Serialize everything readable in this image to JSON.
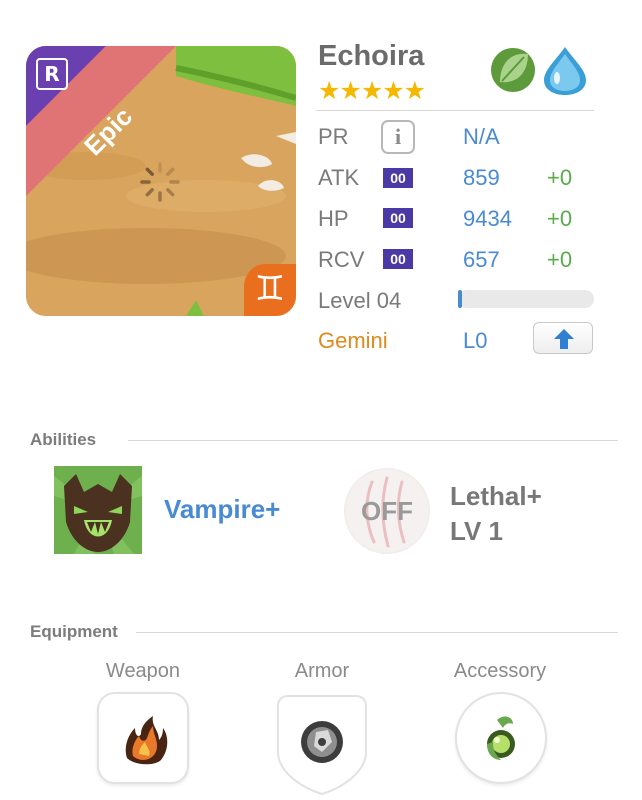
{
  "monster": {
    "name": "Echoira",
    "rarity": "Epic",
    "rank_icon": "R",
    "stars": "★★★★★",
    "star_count": 5,
    "elements": [
      "leaf-element-icon",
      "water-element-icon"
    ],
    "zodiac_symbol": "♊"
  },
  "stats": {
    "pr": {
      "label": "PR",
      "value": "N/A"
    },
    "atk": {
      "label": "ATK",
      "badge": "00",
      "value": "859",
      "bonus": "+0"
    },
    "hp": {
      "label": "HP",
      "badge": "00",
      "value": "9434",
      "bonus": "+0"
    },
    "rcv": {
      "label": "RCV",
      "badge": "00",
      "value": "657",
      "bonus": "+0"
    },
    "level": {
      "label": "Level 04",
      "progress": 0.03
    },
    "zodiac": {
      "label": "Gemini",
      "level": "L0"
    }
  },
  "abilities": {
    "title": "Abilities",
    "active": {
      "name": "Vampire+"
    },
    "leader": {
      "state": "OFF",
      "name": "Lethal+",
      "level": "LV 1"
    }
  },
  "equipment": {
    "title": "Equipment",
    "slots": [
      {
        "label": "Weapon"
      },
      {
        "label": "Armor"
      },
      {
        "label": "Accessory"
      }
    ]
  },
  "colors": {
    "accent_blue": "#4a8ad2",
    "bonus_green": "#5aab4b",
    "zodiac_orange": "#e08a1e",
    "epic_ribbon": "#e07474",
    "rank_corner": "#6a3fb0",
    "star_gold": "#f5b800",
    "badge_purple": "#4b3aa6"
  }
}
